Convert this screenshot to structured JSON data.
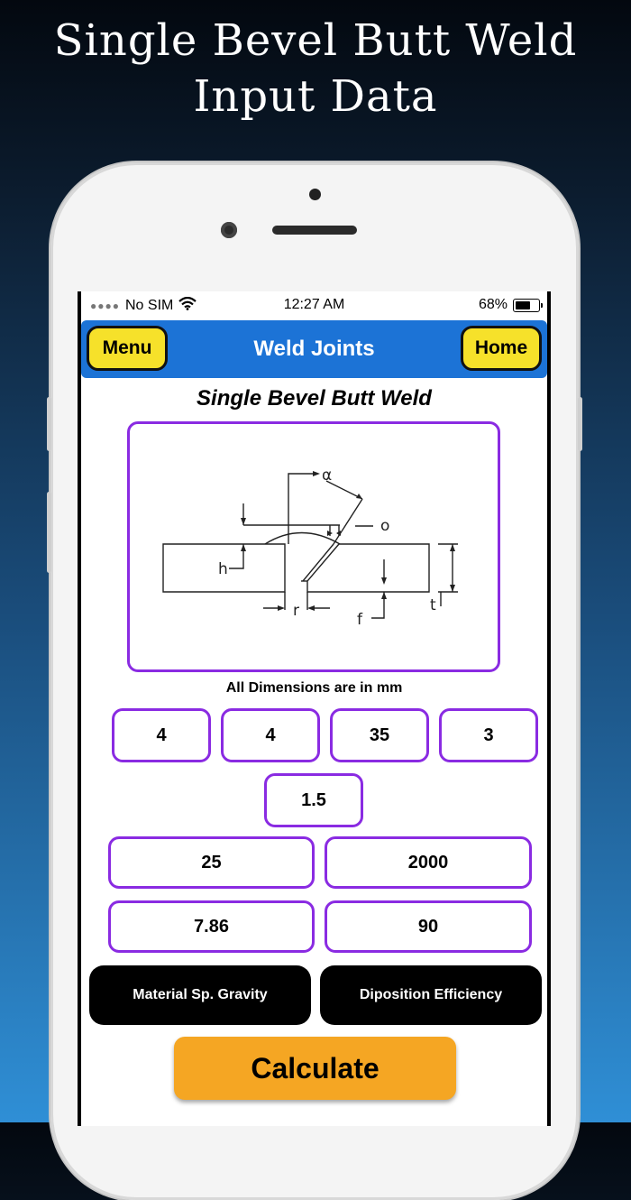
{
  "header": {
    "line1": "Single Bevel Butt Weld",
    "line2": "Input Data"
  },
  "status": {
    "carrier": "No SIM",
    "time": "12:27 AM",
    "battery": "68%",
    "battery_level": 0.68
  },
  "nav": {
    "menu_label": "Menu",
    "title": "Weld Joints",
    "home_label": "Home"
  },
  "page_title": "Single Bevel Butt Weld",
  "diagram": {
    "labels": {
      "alpha": "α",
      "o": "o",
      "h": "h",
      "r": "r",
      "f": "f",
      "t": "t"
    }
  },
  "units_note": "All Dimensions are in mm",
  "inputs": {
    "row1": [
      "4",
      "4",
      "35",
      "3"
    ],
    "single": "1.5",
    "row3": [
      "25",
      "2000"
    ],
    "row4": [
      "7.86",
      "90"
    ]
  },
  "buttons": {
    "sp_gravity": "Material Sp. Gravity",
    "deposition": "Diposition Efficiency",
    "calculate": "Calculate"
  },
  "colors": {
    "nav": "#1c73d6",
    "nav_button": "#f6e12a",
    "border": "#8a2be2",
    "calc": "#f5a623"
  }
}
